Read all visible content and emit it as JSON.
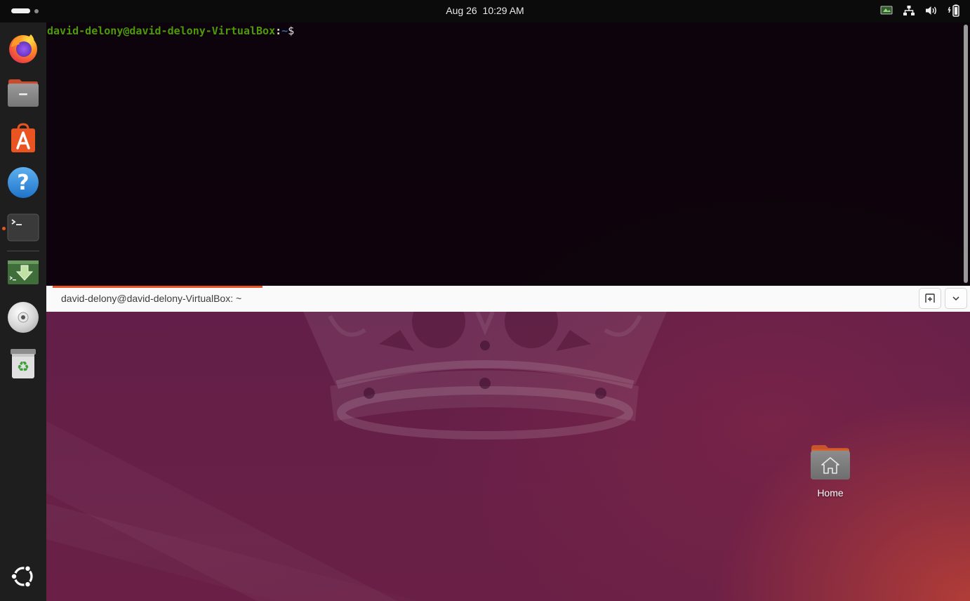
{
  "topbar": {
    "date": "Aug 26",
    "time": "10:29 AM",
    "tray_icons": [
      "display-icon",
      "network-icon",
      "volume-icon",
      "battery-icon"
    ]
  },
  "dock": {
    "apps": [
      {
        "name": "Firefox",
        "icon": "firefox-icon"
      },
      {
        "name": "Files",
        "icon": "files-icon"
      },
      {
        "name": "App Center",
        "icon": "app-center-icon"
      },
      {
        "name": "Help",
        "icon": "help-icon"
      },
      {
        "name": "Terminal",
        "icon": "terminal-icon",
        "running": true
      },
      {
        "name": "Installer",
        "icon": "installer-icon"
      },
      {
        "name": "Disc",
        "icon": "disc-icon"
      },
      {
        "name": "Trash",
        "icon": "trash-icon"
      }
    ],
    "show_apps_icon": "ubuntu-logo-icon"
  },
  "terminal": {
    "prompt_user_host": "david-delony@david-delony-VirtualBox",
    "prompt_colon": ":",
    "prompt_path": "~",
    "prompt_symbol": "$",
    "tab_title": "david-delony@david-delony-VirtualBox: ~",
    "colors": {
      "user": "#4e9a06",
      "path": "#3465a4",
      "accent": "#e95420"
    }
  },
  "desktop": {
    "icons": [
      {
        "label": "Home",
        "icon": "home-folder-icon"
      }
    ]
  }
}
